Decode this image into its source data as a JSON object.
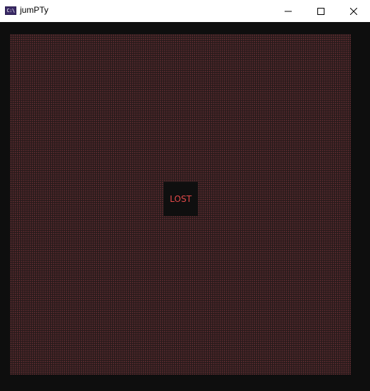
{
  "window": {
    "title": "jumPTy",
    "icon_label": "C:\\"
  },
  "controls": {
    "minimize_icon": "minimize-icon",
    "maximize_icon": "maximize-icon",
    "close_icon": "close-icon"
  },
  "game": {
    "status": "LOST",
    "status_color": "#e04848",
    "board_color": "#2a1b1c"
  }
}
